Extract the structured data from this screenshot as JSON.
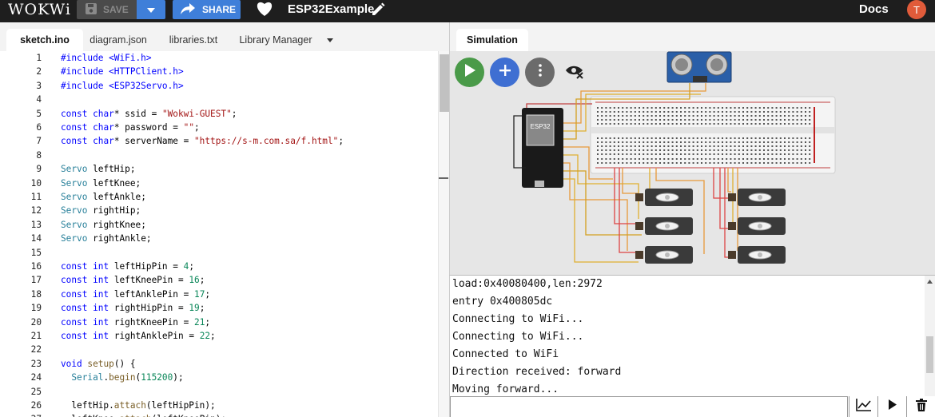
{
  "topbar": {
    "logo": "WOKWi",
    "save_label": "SAVE",
    "share_label": "SHARE",
    "project_title": "ESP32Example",
    "docs_label": "Docs",
    "avatar_initial": "T"
  },
  "editor": {
    "tabs": [
      {
        "label": "sketch.ino",
        "active": true
      },
      {
        "label": "diagram.json",
        "active": false
      },
      {
        "label": "libraries.txt",
        "active": false
      },
      {
        "label": "Library Manager",
        "active": false
      }
    ],
    "lines": [
      {
        "n": "1",
        "text": "#include <WiFi.h>"
      },
      {
        "n": "2",
        "text": "#include <HTTPClient.h>"
      },
      {
        "n": "3",
        "text": "#include <ESP32Servo.h>"
      },
      {
        "n": "4",
        "text": ""
      },
      {
        "n": "5",
        "text": "const char* ssid = \"Wokwi-GUEST\";"
      },
      {
        "n": "6",
        "text": "const char* password = \"\";"
      },
      {
        "n": "7",
        "text": "const char* serverName = \"https://s-m.com.sa/f.html\";"
      },
      {
        "n": "8",
        "text": ""
      },
      {
        "n": "9",
        "text": "Servo leftHip;"
      },
      {
        "n": "10",
        "text": "Servo leftKnee;"
      },
      {
        "n": "11",
        "text": "Servo leftAnkle;"
      },
      {
        "n": "12",
        "text": "Servo rightHip;"
      },
      {
        "n": "13",
        "text": "Servo rightKnee;"
      },
      {
        "n": "14",
        "text": "Servo rightAnkle;"
      },
      {
        "n": "15",
        "text": ""
      },
      {
        "n": "16",
        "text": "const int leftHipPin = 4;"
      },
      {
        "n": "17",
        "text": "const int leftKneePin = 16;"
      },
      {
        "n": "18",
        "text": "const int leftAnklePin = 17;"
      },
      {
        "n": "19",
        "text": "const int rightHipPin = 19;"
      },
      {
        "n": "20",
        "text": "const int rightKneePin = 21;"
      },
      {
        "n": "21",
        "text": "const int rightAnklePin = 22;"
      },
      {
        "n": "22",
        "text": ""
      },
      {
        "n": "23",
        "text": "void setup() {"
      },
      {
        "n": "24",
        "text": "  Serial.begin(115200);"
      },
      {
        "n": "25",
        "text": ""
      },
      {
        "n": "26",
        "text": "  leftHip.attach(leftHipPin);"
      },
      {
        "n": "27",
        "text": "  leftKnee.attach(leftKneePin);"
      }
    ]
  },
  "simulation": {
    "tab_label": "Simulation",
    "chip_label": "ESP32"
  },
  "console": {
    "lines": [
      "load:0x40080400,len:2972",
      "entry 0x400805dc",
      "Connecting to WiFi...",
      "Connecting to WiFi...",
      "Connected to WiFi",
      "Direction received: forward",
      "Moving forward..."
    ]
  },
  "colors": {
    "topbar": "#1e1e1e",
    "accent_blue": "#3f7fd9",
    "play_green": "#4a9a49",
    "add_blue": "#3f6fd2"
  }
}
